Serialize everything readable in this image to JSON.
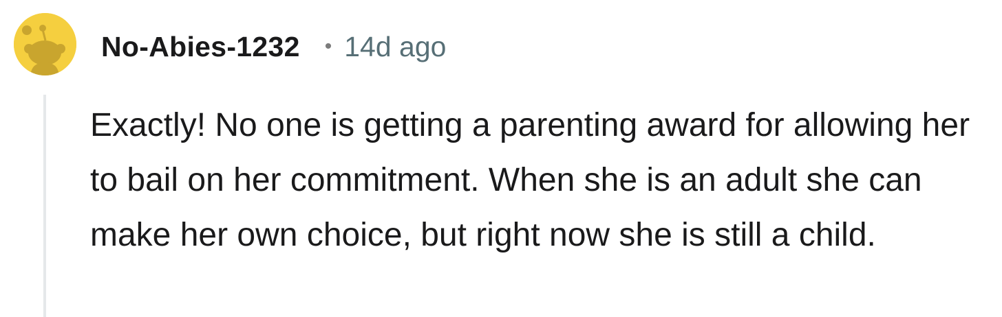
{
  "comment": {
    "avatar_icon": "reddit-snoo-avatar-icon",
    "avatar_color": "#f5cf3f",
    "username": "No-Abies-1232",
    "separator": "•",
    "timestamp": "14d ago",
    "body": "Exactly! No one is getting a parenting award for allowing her to bail on her commitment. When she is an adult she can make her own choice, but right now she is still a child."
  }
}
